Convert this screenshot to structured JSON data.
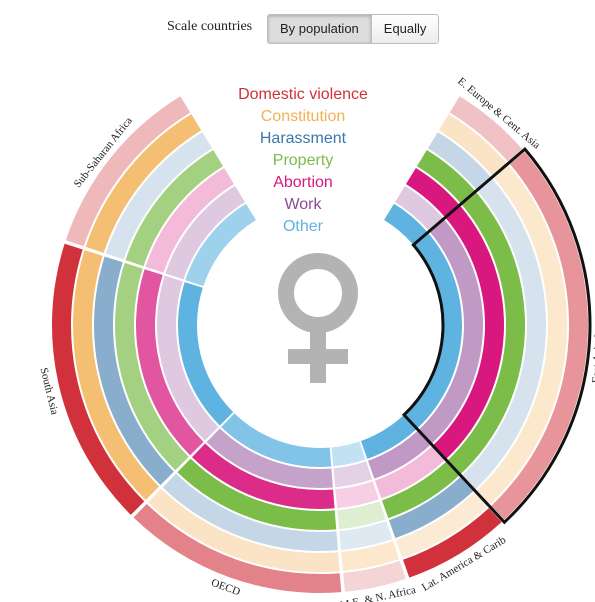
{
  "toolbar": {
    "label": "Scale countries",
    "buttons": [
      "By population",
      "Equally"
    ],
    "active": "By population"
  },
  "chart_data": {
    "type": "radial-stacked-rings",
    "categories": [
      "Domestic violence",
      "Constitution",
      "Harassment",
      "Property",
      "Abortion",
      "Work",
      "Other"
    ],
    "category_colors": [
      "#d0313b",
      "#f2b055",
      "#3b77ad",
      "#7cbd49",
      "#d8187e",
      "#8e4a96",
      "#5fb3e0"
    ],
    "regions": [
      "E. Europe & Cent. Asia",
      "East Asia & Pacific",
      "Lat. America & Carib",
      "M.E. & N. Africa",
      "OECD",
      "South Asia",
      "Sub-Saharan Africa"
    ],
    "population_share_pct": [
      6.5,
      31,
      8.5,
      5,
      17.5,
      22.5,
      14.5
    ],
    "highlighted_region": "East Asia & Pacific",
    "rings": [
      {
        "category": "Domestic violence",
        "fill_levels": [
          0.2,
          0.45,
          1,
          0.1,
          0.55,
          1,
          0.25
        ]
      },
      {
        "category": "Constitution",
        "fill_levels": [
          0.25,
          0.2,
          0.15,
          0.2,
          0.25,
          0.8,
          0.8
        ]
      },
      {
        "category": "Harassment",
        "fill_levels": [
          0.2,
          0.1,
          0.55,
          0.05,
          0.2,
          0.55,
          0.1
        ]
      },
      {
        "category": "Property",
        "fill_levels": [
          1,
          1,
          1,
          0.15,
          1,
          0.65,
          0.65
        ]
      },
      {
        "category": "Abortion",
        "fill_levels": [
          1,
          1,
          0.2,
          0.1,
          0.9,
          0.7,
          0.2
        ]
      },
      {
        "category": "Work",
        "fill_levels": [
          0.2,
          0.5,
          0.5,
          0.15,
          0.45,
          0.2,
          0.2
        ]
      },
      {
        "category": "Other",
        "fill_levels": [
          1,
          1,
          1,
          0.3,
          0.75,
          1,
          0.55
        ]
      }
    ],
    "center_icon": "female-symbol-icon"
  }
}
